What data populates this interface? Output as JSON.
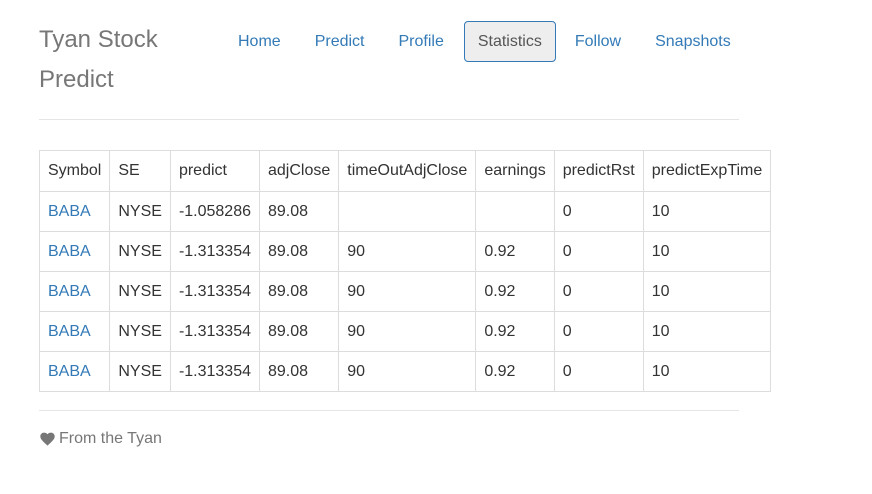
{
  "brand": {
    "title": "Tyan Stock Predict"
  },
  "nav": {
    "items": [
      {
        "label": "Home",
        "active": false
      },
      {
        "label": "Predict",
        "active": false
      },
      {
        "label": "Profile",
        "active": false
      },
      {
        "label": "Statistics",
        "active": true
      },
      {
        "label": "Follow",
        "active": false
      },
      {
        "label": "Snapshots",
        "active": false
      }
    ]
  },
  "table": {
    "headers": [
      "Symbol",
      "SE",
      "predict",
      "adjClose",
      "timeOutAdjClose",
      "earnings",
      "predictRst",
      "predictExpTime"
    ],
    "rows": [
      [
        "BABA",
        "NYSE",
        "-1.058286",
        "89.08",
        "",
        "",
        "0",
        "10"
      ],
      [
        "BABA",
        "NYSE",
        "-1.313354",
        "89.08",
        "90",
        "0.92",
        "0",
        "10"
      ],
      [
        "BABA",
        "NYSE",
        "-1.313354",
        "89.08",
        "90",
        "0.92",
        "0",
        "10"
      ],
      [
        "BABA",
        "NYSE",
        "-1.313354",
        "89.08",
        "90",
        "0.92",
        "0",
        "10"
      ],
      [
        "BABA",
        "NYSE",
        "-1.313354",
        "89.08",
        "90",
        "0.92",
        "0",
        "10"
      ]
    ]
  },
  "footer": {
    "icon": "heart-icon",
    "text": "From the Tyan"
  },
  "colors": {
    "link": "#337ab7",
    "muted": "#777777",
    "border": "#dddddd"
  }
}
